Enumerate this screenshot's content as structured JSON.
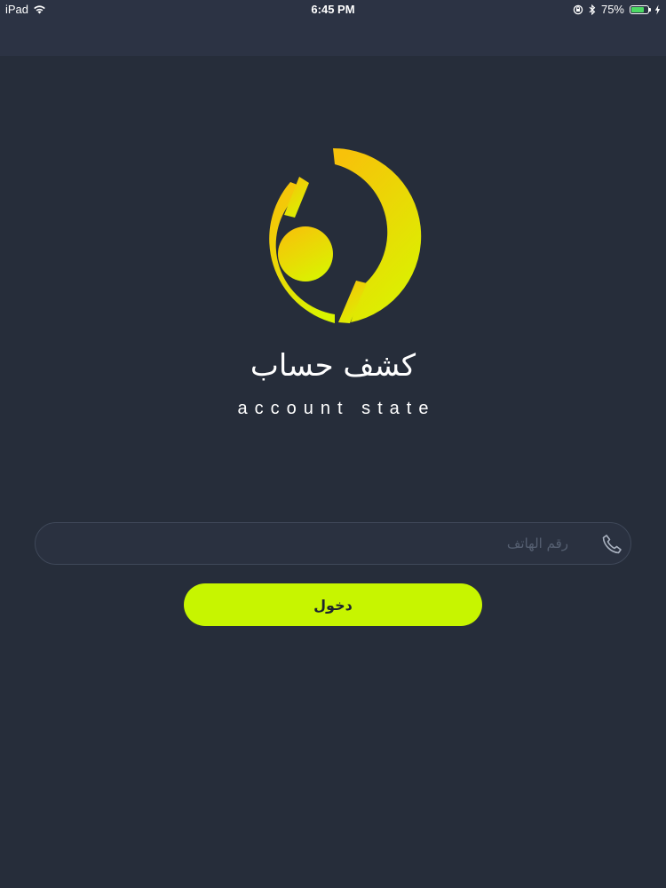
{
  "status_bar": {
    "device": "iPad",
    "time": "6:45 PM",
    "battery_percent_text": "75%",
    "battery_level": 0.75,
    "icons": [
      "wifi-icon",
      "orientation-lock-icon",
      "bluetooth-icon",
      "battery-icon",
      "charging-bolt-icon"
    ]
  },
  "brand": {
    "name_ar": "كشف حساب",
    "name_en": "account state",
    "logo_icon": "brand-logo-icon",
    "logo_gradient": [
      "#f7c20a",
      "#d9f400"
    ]
  },
  "login": {
    "phone_placeholder": "رقم الهاتف",
    "phone_value": "",
    "phone_icon": "phone-icon",
    "submit_label": "دخول"
  },
  "colors": {
    "background": "#262d3a",
    "header": "#2c3344",
    "accent": "#c7f500"
  }
}
